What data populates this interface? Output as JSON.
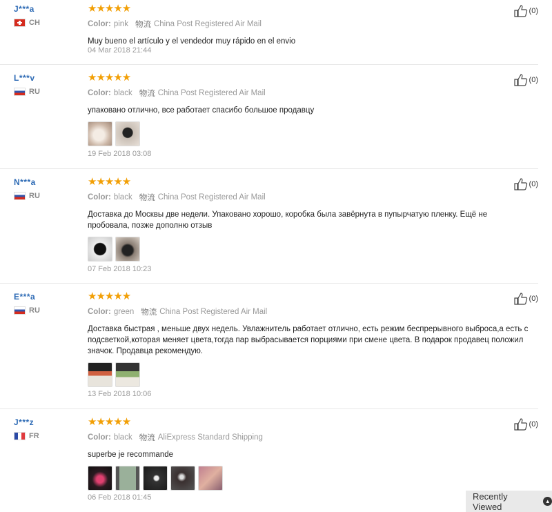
{
  "reviews": [
    {
      "user": "J***a",
      "country": "CH",
      "flag": "ch",
      "rating": 5,
      "stars": "★★★★★",
      "color_label": "Color:",
      "color": "pink",
      "ship_icon": "物流",
      "shipping": "China Post Registered Air Mail",
      "text": "Muy bueno el artículo y el vendedor muy rápido en el envio",
      "thumbnails": [],
      "date": "04 Mar 2018 21:44",
      "likes": "(0)"
    },
    {
      "user": "L***v",
      "country": "RU",
      "flag": "ru",
      "rating": 5,
      "stars": "★★★★★",
      "color_label": "Color:",
      "color": "black",
      "ship_icon": "物流",
      "shipping": "China Post Registered Air Mail",
      "text": "упаковано отлично, все работает спасибо большое продавцу",
      "thumbnails": [
        "#cdb8a8",
        "#3a3a3a"
      ],
      "date": "19 Feb 2018 03:08",
      "likes": "(0)"
    },
    {
      "user": "N***a",
      "country": "RU",
      "flag": "ru",
      "rating": 5,
      "stars": "★★★★★",
      "color_label": "Color:",
      "color": "black",
      "ship_icon": "物流",
      "shipping": "China Post Registered Air Mail",
      "text": "Доставка до Москвы две недели. Упаковано хорошо, коробка была завёрнута в пупырчатую пленку. Ещё не пробовала, позже дополню отзыв",
      "thumbnails": [
        "#2a2a2a",
        "#6b6058"
      ],
      "date": "07 Feb 2018 10:23",
      "likes": "(0)"
    },
    {
      "user": "E***a",
      "country": "RU",
      "flag": "ru",
      "rating": 5,
      "stars": "★★★★★",
      "color_label": "Color:",
      "color": "green",
      "ship_icon": "物流",
      "shipping": "China Post Registered Air Mail",
      "text": "Доставка быстрая , меньше двух недель. Увлажнитель работает отлично, есть режим беспрерывного выброса,а есть с подсветкой,которая меняет цвета,тогда пар выбрасывается порциями при смене цвета. В подарок продавец положил значок. Продавца рекомендую.",
      "thumbnails": [
        "#8fae7a",
        "#a9c08a"
      ],
      "date": "13 Feb 2018 10:06",
      "likes": "(0)"
    },
    {
      "user": "J***z",
      "country": "FR",
      "flag": "fr",
      "rating": 5,
      "stars": "★★★★★",
      "color_label": "Color:",
      "color": "black",
      "ship_icon": "物流",
      "shipping": "AliExpress Standard Shipping",
      "text": "superbe je recommande",
      "thumbnails": [
        "#5a2a3a",
        "#8a9a8a",
        "#3a3030",
        "#4a4040",
        "#b07a8a"
      ],
      "date": "06 Feb 2018 01:45",
      "likes": "(0)"
    }
  ],
  "recently_viewed": {
    "label": "Recently Viewed",
    "icon": "chevron-up-icon"
  }
}
